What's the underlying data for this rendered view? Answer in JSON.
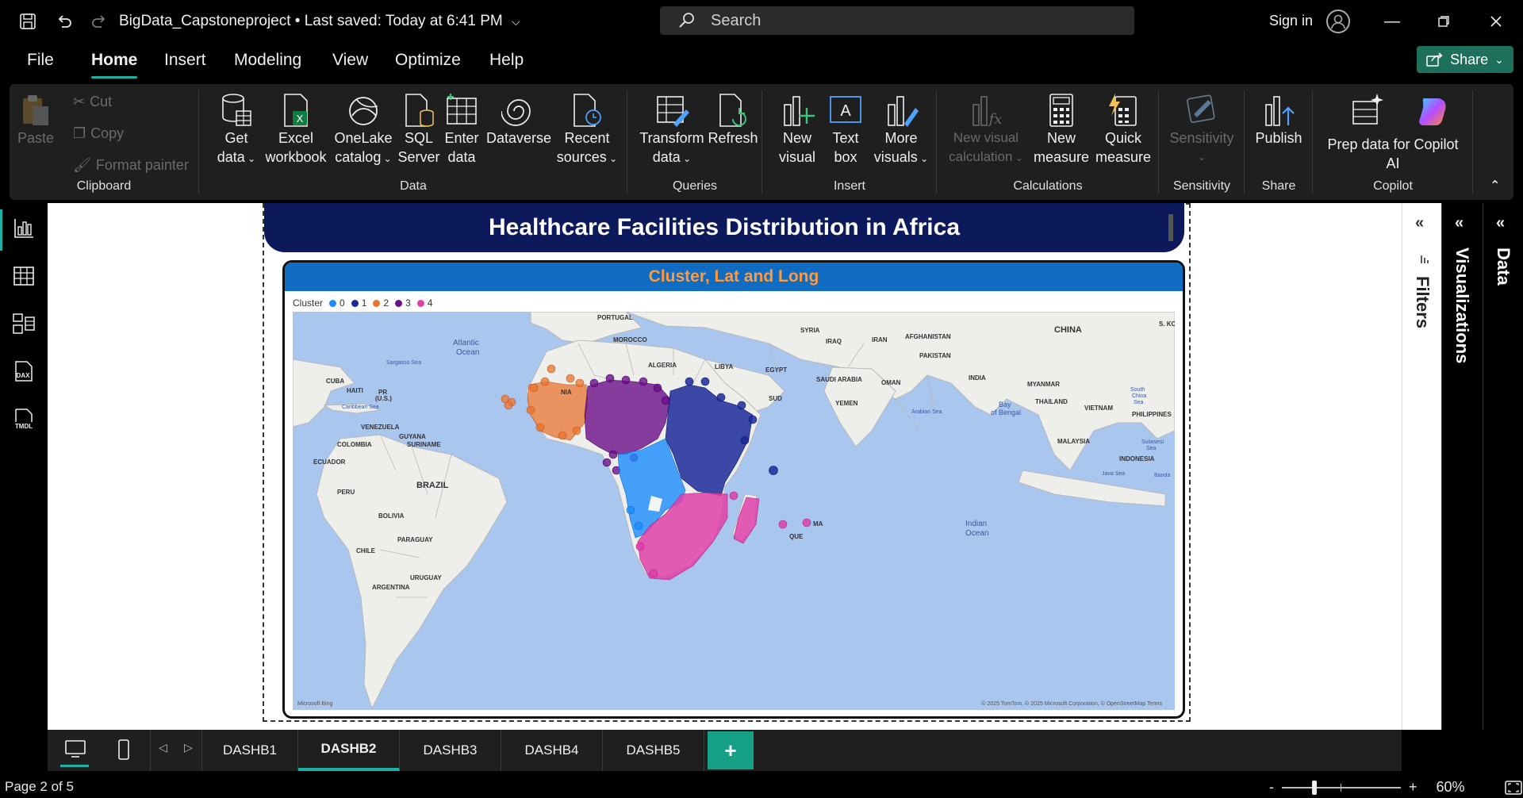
{
  "titlebar": {
    "doc_title": "BigData_Capstoneproject • Last saved: Today at 6:41 PM",
    "search_placeholder": "Search",
    "sign_in": "Sign in"
  },
  "menu": {
    "items": [
      "File",
      "Home",
      "Insert",
      "Modeling",
      "View",
      "Optimize",
      "Help"
    ],
    "active": "Home",
    "share": "Share"
  },
  "ribbon": {
    "clipboard": {
      "label": "Clipboard",
      "paste": "Paste",
      "cut": "Cut",
      "copy": "Copy",
      "format_painter": "Format painter"
    },
    "data": {
      "label": "Data",
      "get_data": [
        "Get",
        "data"
      ],
      "excel": [
        "Excel",
        "workbook"
      ],
      "onelake": [
        "OneLake",
        "catalog"
      ],
      "sql": [
        "SQL",
        "Server"
      ],
      "enter": [
        "Enter",
        "data"
      ],
      "dataverse": [
        "Dataverse"
      ],
      "recent": [
        "Recent",
        "sources"
      ]
    },
    "queries": {
      "label": "Queries",
      "transform": [
        "Transform",
        "data"
      ],
      "refresh": [
        "Refresh"
      ]
    },
    "insert": {
      "label": "Insert",
      "new_visual": [
        "New",
        "visual"
      ],
      "text_box": [
        "Text",
        "box"
      ],
      "more_visuals": [
        "More",
        "visuals"
      ]
    },
    "calculations": {
      "label": "Calculations",
      "new_visual_calc": [
        "New visual",
        "calculation"
      ],
      "new_measure": [
        "New",
        "measure"
      ],
      "quick_measure": [
        "Quick",
        "measure"
      ]
    },
    "sensitivity": {
      "label": "Sensitivity",
      "sensitivity": [
        "Sensitivity"
      ]
    },
    "share": {
      "label": "Share",
      "publish": [
        "Publish"
      ]
    },
    "copilot": {
      "label": "Copilot",
      "prep": [
        "Prep data for Copilot",
        "AI"
      ]
    }
  },
  "report": {
    "header_title": "Healthcare Facilities Distribution in Africa",
    "visual_title": "Cluster, Lat and Long",
    "legend_title": "Cluster",
    "legend": [
      {
        "label": "0",
        "color": "#1a8cff"
      },
      {
        "label": "1",
        "color": "#1b2a9a"
      },
      {
        "label": "2",
        "color": "#e8742f"
      },
      {
        "label": "3",
        "color": "#6a0f8a"
      },
      {
        "label": "4",
        "color": "#e040a8"
      }
    ],
    "map_labels": {
      "portugal": "PORTUGAL",
      "morocco": "MOROCCO",
      "algeria": "ALGERIA",
      "libya": "LIBYA",
      "egypt": "EGYPT",
      "syria": "SYRIA",
      "iraq": "IRAQ",
      "iran": "IRAN",
      "afghanistan": "AFGHANISTAN",
      "pakistan": "PAKISTAN",
      "china": "CHINA",
      "skorea": "S. KO",
      "india": "INDIA",
      "myanmar": "MYANMAR",
      "thailand": "THAILAND",
      "vietnam": "VIETNAM",
      "philippines": "PHILIPPINES",
      "malaysia": "MALAYSIA",
      "indonesia": "INDONESIA",
      "saudi": "SAUDI ARABIA",
      "oman": "OMAN",
      "yemen": "YEMEN",
      "sudan": "SUD",
      "atlantic": "Atlantic",
      "ocean": "Ocean",
      "sargasso": "Sargasso Sea",
      "cuba": "CUBA",
      "haiti": "HAITI",
      "pr": "PR",
      "pr2": "(U.S.)",
      "caribbean": "Caribbean Sea",
      "venezuela": "VENEZUELA",
      "guyana": "GUYANA",
      "suriname": "SURINAME",
      "colombia": "COLOMBIA",
      "ecuador": "ECUADOR",
      "brazil": "BRAZIL",
      "peru": "PERU",
      "bolivia": "BOLIVIA",
      "paraguay": "PARAGUAY",
      "chile": "CHILE",
      "uruguay": "URUGUAY",
      "argentina": "ARGENTINA",
      "arabian": "Arabian Sea",
      "bay": "Bay",
      "bengal": "of Bengal",
      "scs1": "South",
      "scs2": "China",
      "scs3": "Sea",
      "sulawesi": "Sulawesi",
      "sulsea": "Sea",
      "banda": "Banda",
      "java": "Java Sea",
      "indian": "Indian",
      "indocean": "Ocean",
      "madag": "MA",
      "moz": "QUE",
      "nia": "NIA"
    },
    "attribution": "© 2025 TomTom, © 2025 Microsoft Corporation, © OpenStreetMap  Terms",
    "bing": "Microsoft Bing"
  },
  "panes": {
    "filters": "Filters",
    "visualizations": "Visualizations",
    "data": "Data"
  },
  "tabs": [
    "DASHB1",
    "DASHB2",
    "DASHB3",
    "DASHB4",
    "DASHB5"
  ],
  "active_tab": "DASHB2",
  "status": {
    "page": "Page 2 of 5",
    "zoom": "60%",
    "zoom_fraction": 0.27
  },
  "colors": {
    "accent": "#1bb1a4",
    "share": "#1e6f5c",
    "banner": "#0c1a5c",
    "visual_bar": "#0f6cc2",
    "visual_title": "#ff9a3c"
  }
}
